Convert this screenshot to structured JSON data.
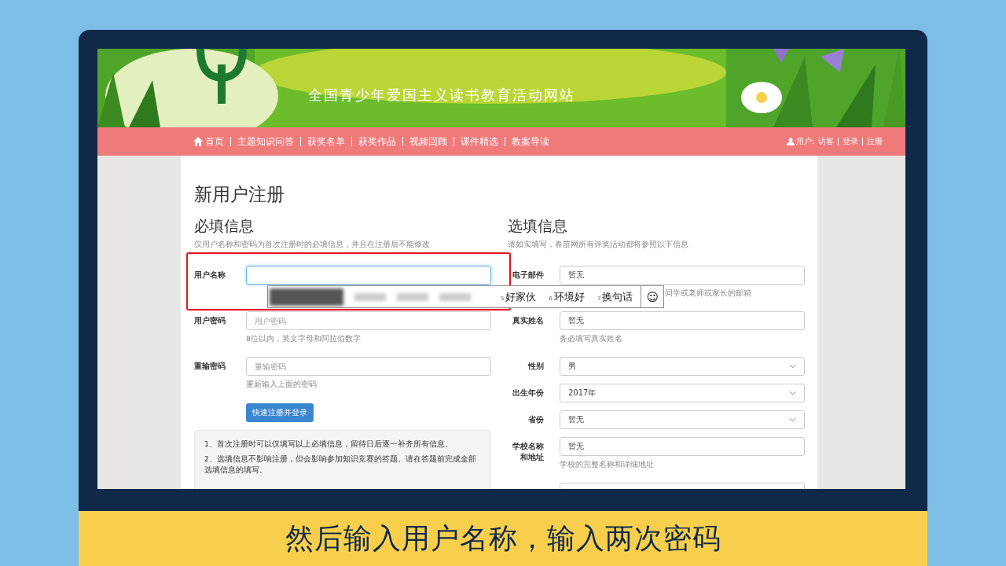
{
  "banner": {
    "subtitle": "全国青少年爱国主义读书教育活动网站"
  },
  "nav": {
    "items": [
      {
        "label": "首页",
        "kind": "home"
      },
      {
        "label": "主题知识问答",
        "kind": "link"
      },
      {
        "label": "获奖名单",
        "kind": "link"
      },
      {
        "label": "获奖作品",
        "kind": "link"
      },
      {
        "label": "视频回顾",
        "kind": "link"
      },
      {
        "label": "课件精选",
        "kind": "link"
      },
      {
        "label": "教案导读",
        "kind": "link"
      }
    ],
    "user": {
      "label": "用户:",
      "name": "访客",
      "links": [
        "登录",
        "注册"
      ]
    }
  },
  "page_title": "新用户注册",
  "required": {
    "heading": "必填信息",
    "note": "仅用户名称和密码为首次注册时的必填信息，并且在注册后不能修改",
    "fields": [
      {
        "label": "用户名称",
        "focused": true
      },
      {
        "label": "用户密码",
        "placeholder": "用户密码",
        "hint": "8位以内，英文字母和阿拉伯数字",
        "focused": false
      },
      {
        "label": "重输密码",
        "placeholder": "重输密码",
        "hint": "重新输入上面的密码",
        "focused": false
      }
    ],
    "button": "快速注册并登录",
    "notes": [
      "1、首次注册时可以仅填写以上必填信息，留待日后逐一补齐所有信息。",
      "2、选填信息不影响注册，但会影响参加知识竞赛的答题。请在答题前完成全部选填信息的填写。"
    ]
  },
  "optional": {
    "heading": "选填信息",
    "note": "请如实填写，春苗网所有评奖活动都将参照以下信息",
    "fields": [
      {
        "label": "电子邮件",
        "kind": "text",
        "value": "暂无",
        "hint": "同学或老师或家长的邮箱",
        "hint_covered": true
      },
      {
        "label": "真实姓名",
        "kind": "text",
        "value": "暂无",
        "hint": "务必填写真实姓名"
      },
      {
        "label": "性别",
        "kind": "select",
        "value": "男"
      },
      {
        "label": "出生年份",
        "kind": "select",
        "value": "2017年"
      },
      {
        "label": "省份",
        "kind": "select",
        "value": "暂无"
      },
      {
        "label": "学校名称和地址",
        "kind": "text",
        "value": "暂无",
        "hint": "学校的完整名称和详细地址"
      }
    ]
  },
  "candidates": {
    "items": [
      {
        "index": "5",
        "text": "好家伙"
      },
      {
        "index": "6",
        "text": "环境好"
      },
      {
        "index": "7",
        "text": "换句话"
      }
    ],
    "emoji": "☺"
  },
  "caption": "然后输入用户名称，输入两次密码"
}
